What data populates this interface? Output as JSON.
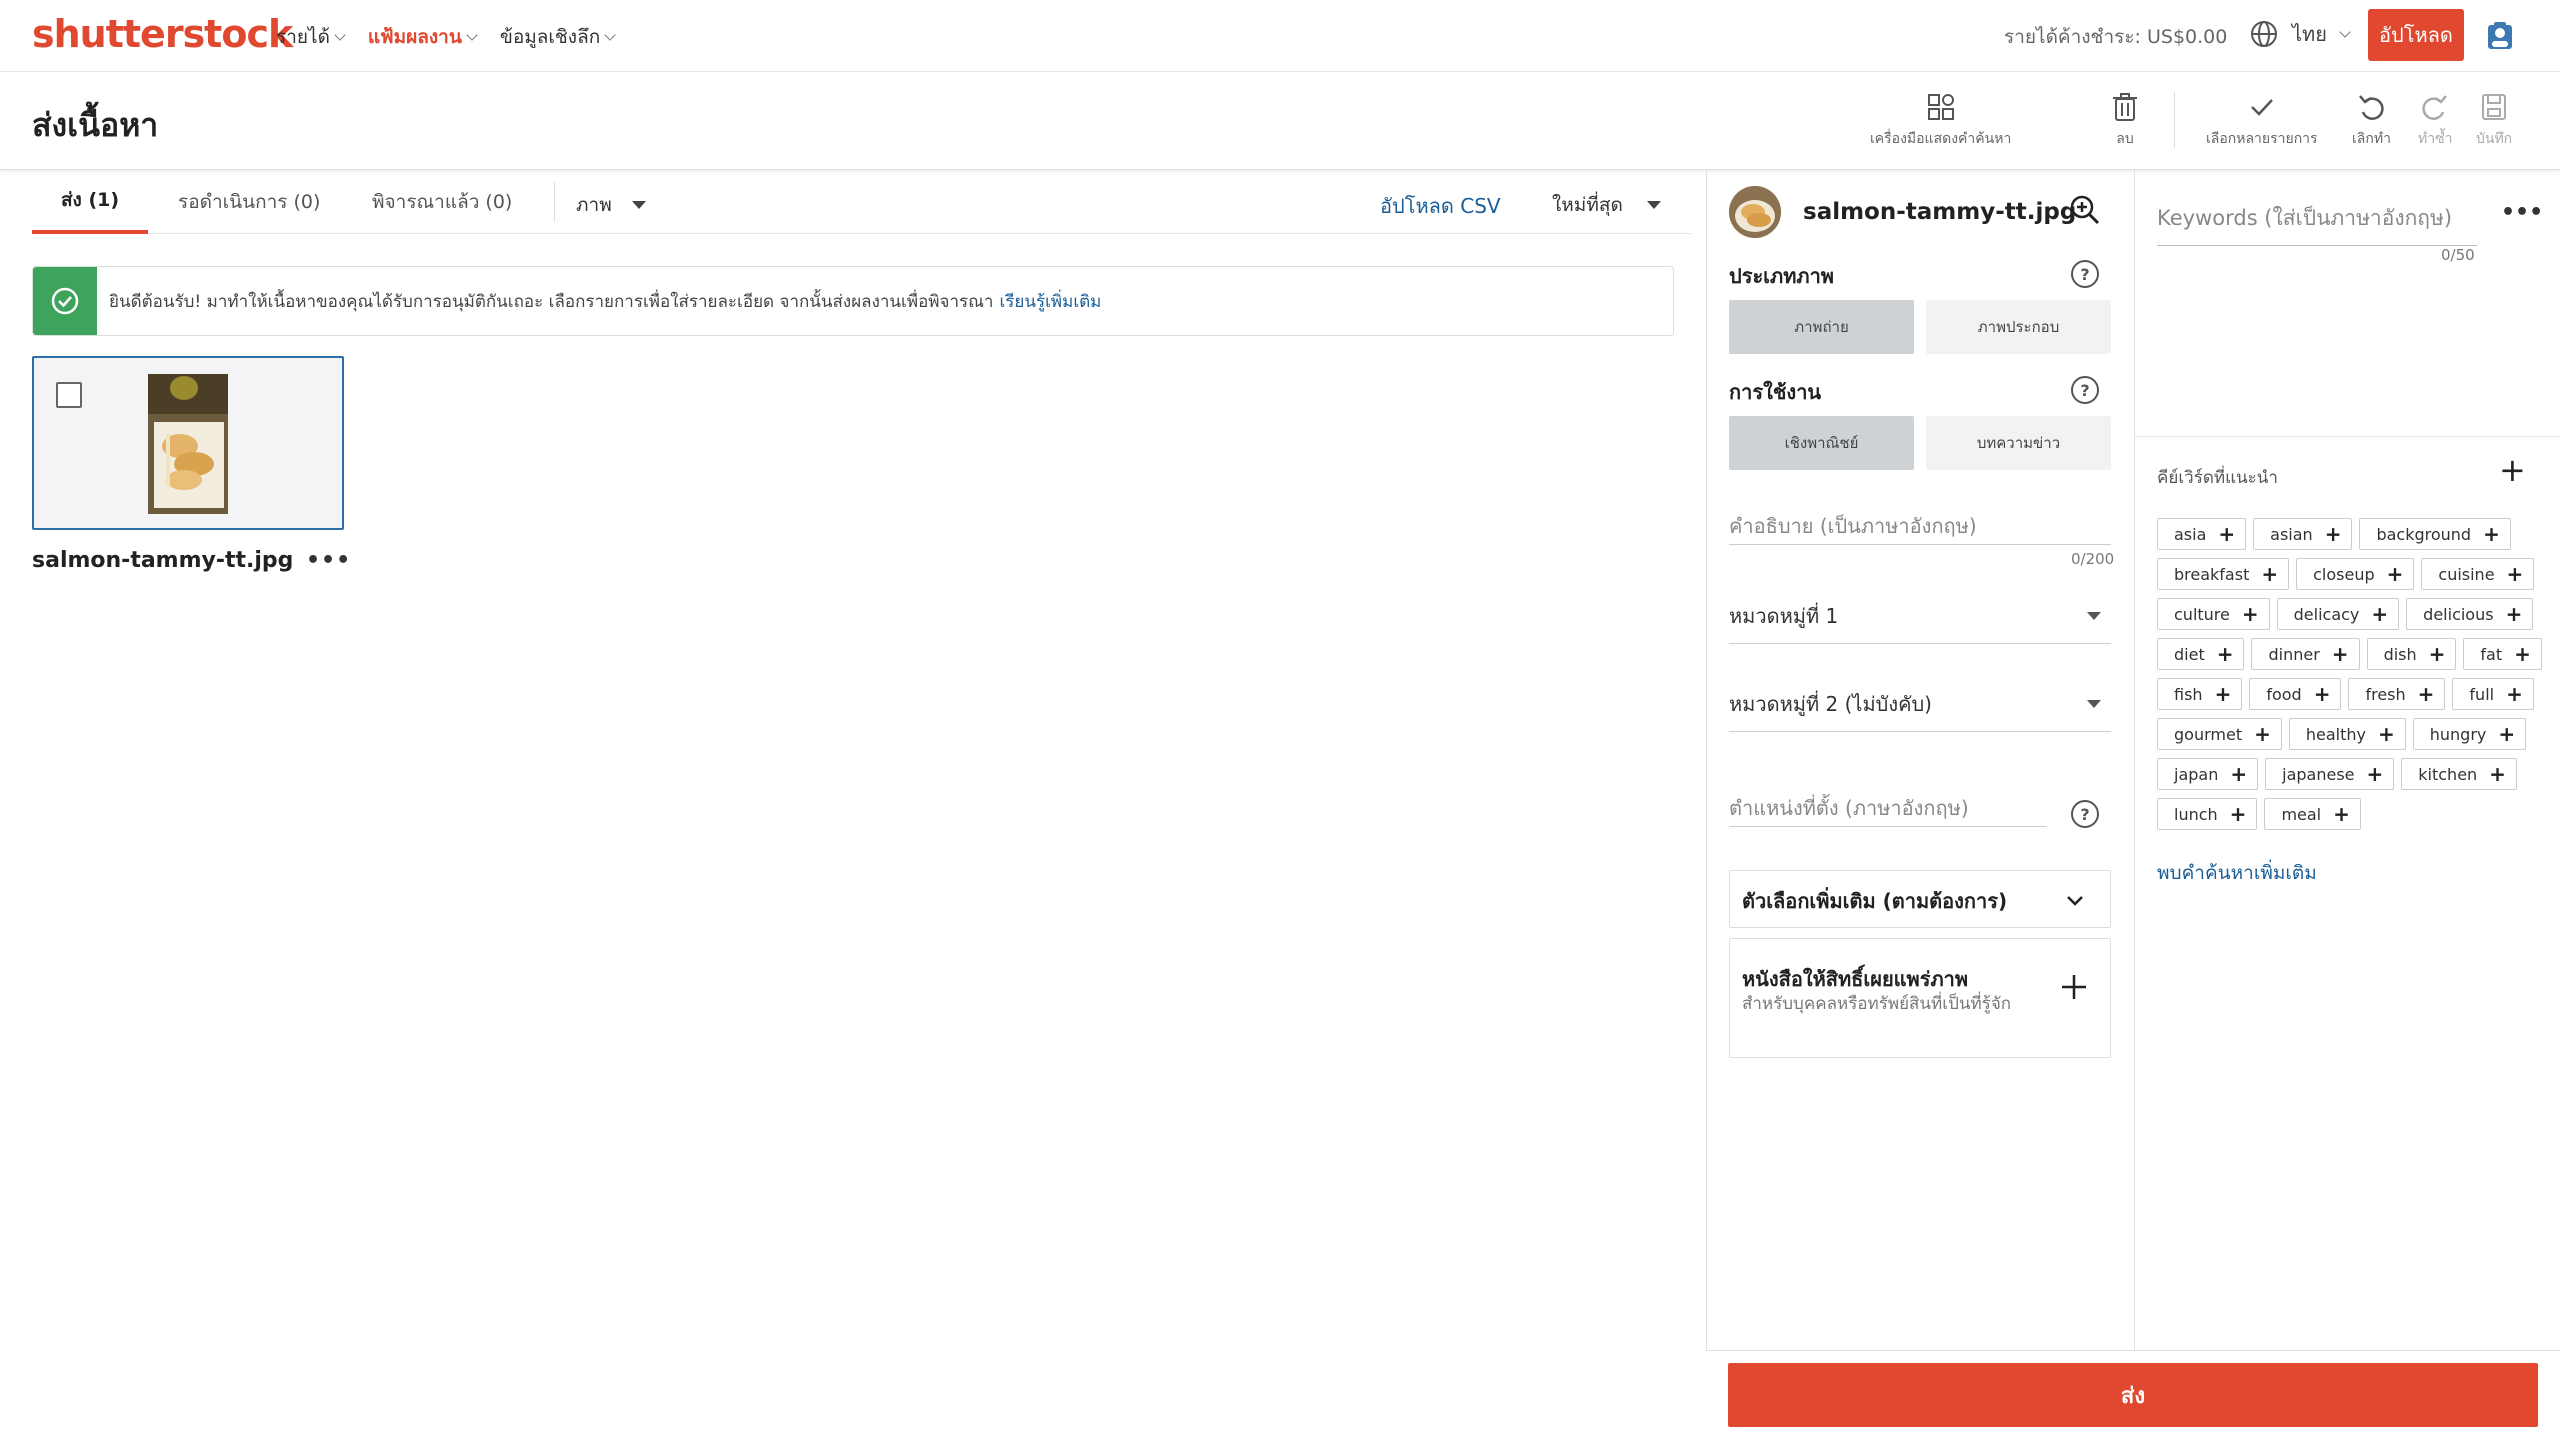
{
  "nav": {
    "logo": "shutterstock",
    "menu": [
      {
        "label": "รายได้"
      },
      {
        "label": "แฟ้มผลงาน"
      },
      {
        "label": "ข้อมูลเชิงลึก"
      }
    ],
    "earnings": "รายได้ค้างชำระ: US$0.00",
    "language": "ไทย",
    "upload": "อัปโหลด"
  },
  "header": {
    "title": "ส่งเนื้อหา",
    "tools": {
      "keyword_tool": "เครื่องมือแสดงคำค้นหา",
      "delete": "ลบ",
      "select_multiple": "เลือกหลายรายการ",
      "undo": "เลิกทำ",
      "redo": "ทำซ้ำ",
      "save": "บันทึก"
    }
  },
  "tabs": {
    "submit": "ส่ง (1)",
    "pending": "รอดำเนินการ (0)",
    "reviewed": "พิจารณาแล้ว (0)",
    "type": "ภาพ",
    "csv": "อัปโหลด CSV",
    "sort": "ใหม่ที่สุด"
  },
  "alert": {
    "text": "ยินดีต้อนรับ! มาทำให้เนื้อหาของคุณได้รับการอนุมัติกันเถอะ เลือกรายการเพื่อใส่รายละเอียด จากนั้นส่งผลงานเพื่อพิจารณา",
    "link": "เรียนรู้เพิ่มเติม"
  },
  "asset": {
    "filename": "salmon-tammy-tt.jpg",
    "more": "•••"
  },
  "details": {
    "filename": "salmon-tammy-tt.jpg",
    "image_type_label": "ประเภทภาพ",
    "image_type_options": [
      "ภาพถ่าย",
      "ภาพประกอบ"
    ],
    "usage_label": "การใช้งาน",
    "usage_options": [
      "เชิงพาณิชย์",
      "บทความข่าว"
    ],
    "description_placeholder": "คำอธิบาย (เป็นภาษาอังกฤษ)",
    "description_count": "0/200",
    "category1": "หมวดหมู่ที่ 1",
    "category2": "หมวดหมู่ที่ 2 (ไม่บังคับ)",
    "location_placeholder": "ตำแหน่งที่ตั้ง (ภาษาอังกฤษ)",
    "more_options": "ตัวเลือกเพิ่มเติม (ตามต้องการ)",
    "release_title": "หนังสือให้สิทธิ์เผยแพร่ภาพ",
    "release_subtitle": "สำหรับบุคคลหรือทรัพย์สินที่เป็นที่รู้จัก"
  },
  "keywords": {
    "placeholder": "Keywords (ใส่เป็นภาษาอังกฤษ)",
    "count": "0/50",
    "suggested_title": "คีย์เวิร์ดที่แนะนำ",
    "suggested": [
      "asia",
      "asian",
      "background",
      "breakfast",
      "closeup",
      "cuisine",
      "culture",
      "delicacy",
      "delicious",
      "diet",
      "dinner",
      "dish",
      "fat",
      "fish",
      "food",
      "fresh",
      "full",
      "gourmet",
      "healthy",
      "hungry",
      "japan",
      "japanese",
      "kitchen",
      "lunch",
      "meal"
    ],
    "more_link": "พบคำค้นหาเพิ่มเติม"
  },
  "submit": "ส่ง",
  "colors": {
    "brand": "#e0482f",
    "link": "#1a5d97",
    "success": "#3fa45b"
  }
}
